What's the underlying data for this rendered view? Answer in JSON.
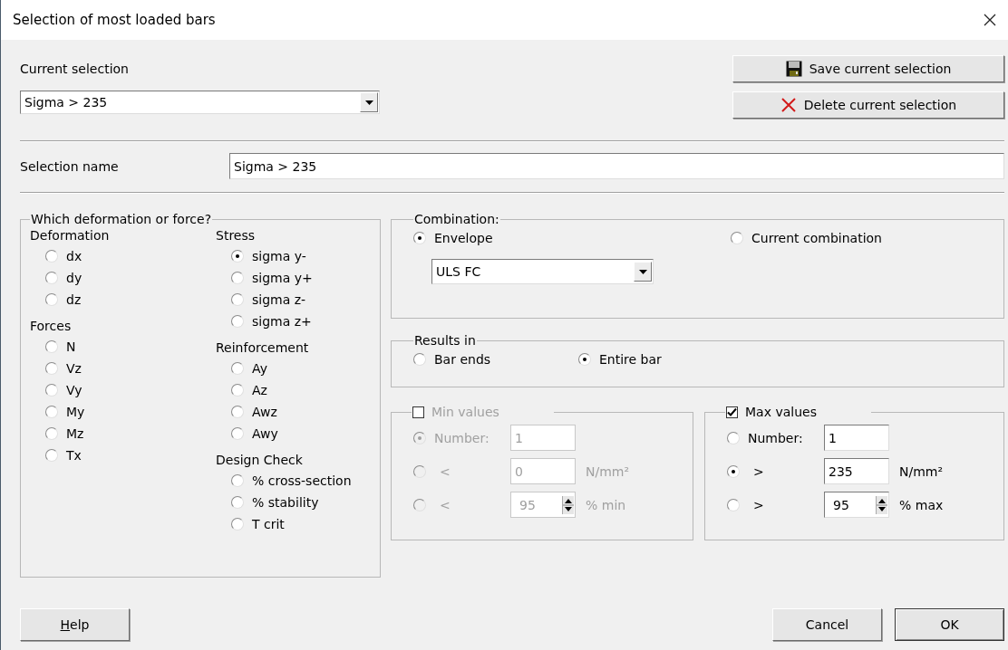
{
  "window": {
    "title": "Selection of most loaded bars"
  },
  "current_selection": {
    "label": "Current selection",
    "value": "Sigma > 235"
  },
  "selection_buttons": [
    {
      "kind": "save",
      "label": "Save current selection"
    },
    {
      "kind": "delete",
      "label": "Delete current selection"
    }
  ],
  "selection_name": {
    "label": "Selection name",
    "value": "Sigma > 235"
  },
  "quantity": {
    "title": "Which deformation or force?",
    "columns": [
      [
        {
          "heading": "Deformation",
          "options": [
            {
              "label": "dx",
              "selected": false
            },
            {
              "label": "dy",
              "selected": false
            },
            {
              "label": "dz",
              "selected": false
            }
          ]
        },
        {
          "heading": "Forces",
          "options": [
            {
              "label": "N",
              "selected": false
            },
            {
              "label": "Vz",
              "selected": false
            },
            {
              "label": "Vy",
              "selected": false
            },
            {
              "label": "My",
              "selected": false
            },
            {
              "label": "Mz",
              "selected": false
            },
            {
              "label": "Tx",
              "selected": false
            }
          ]
        }
      ],
      [
        {
          "heading": "Stress",
          "options": [
            {
              "label": "sigma y-",
              "selected": true
            },
            {
              "label": "sigma y+",
              "selected": false
            },
            {
              "label": "sigma z-",
              "selected": false
            },
            {
              "label": "sigma z+",
              "selected": false
            }
          ]
        },
        {
          "heading": "Reinforcement",
          "options": [
            {
              "label": "Ay",
              "selected": false
            },
            {
              "label": "Az",
              "selected": false
            },
            {
              "label": "Awz",
              "selected": false
            },
            {
              "label": "Awy",
              "selected": false
            }
          ]
        },
        {
          "heading": "Design Check",
          "options": [
            {
              "label": "% cross-section",
              "selected": false
            },
            {
              "label": "% stability",
              "selected": false
            },
            {
              "label": "T crit",
              "selected": false
            }
          ]
        }
      ]
    ]
  },
  "combination": {
    "title": "Combination:",
    "options": [
      {
        "label": "Envelope",
        "selected": true
      },
      {
        "label": "Current combination",
        "selected": false
      }
    ],
    "envelope_dropdown": "ULS FC"
  },
  "results_in": {
    "title": "Results in",
    "options": [
      {
        "label": "Bar ends",
        "selected": false
      },
      {
        "label": "Entire bar",
        "selected": true
      }
    ]
  },
  "limits": [
    {
      "label": "Min values",
      "checked": false,
      "rows": [
        {
          "kind": "number",
          "label": "Number:",
          "selected": true,
          "value": "1"
        },
        {
          "kind": "value",
          "label": "<",
          "selected": false,
          "value": "0",
          "unit": "N/mm²"
        },
        {
          "kind": "spin",
          "label": "<",
          "selected": false,
          "value": "95",
          "unit": "% min"
        }
      ]
    },
    {
      "label": "Max values",
      "checked": true,
      "rows": [
        {
          "kind": "number",
          "label": "Number:",
          "selected": false,
          "value": "1"
        },
        {
          "kind": "value",
          "label": ">",
          "selected": true,
          "value": "235",
          "unit": "N/mm²"
        },
        {
          "kind": "spin",
          "label": ">",
          "selected": false,
          "value": "95",
          "unit": "% max"
        }
      ]
    }
  ],
  "footer": {
    "left": [
      {
        "access_key": "H",
        "label_rest": "elp"
      }
    ],
    "right": [
      {
        "label": "Cancel"
      },
      {
        "label": "OK"
      }
    ]
  }
}
